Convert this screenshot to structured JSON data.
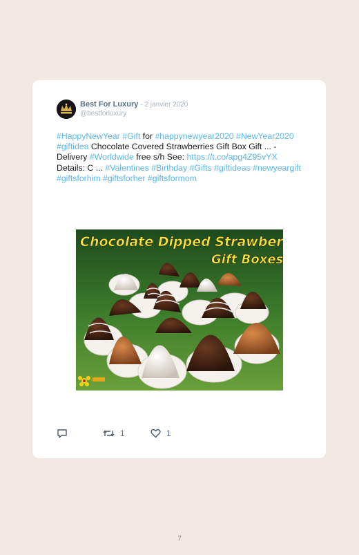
{
  "post": {
    "author_name": "Best For Luxury",
    "date": "- 2 janvier 2020",
    "handle": "@bestforluxury",
    "text_parts": [
      {
        "text": "#HappyNewYear",
        "tag": true
      },
      {
        "text": " "
      },
      {
        "text": "#Gift",
        "tag": true
      },
      {
        "text": " for "
      },
      {
        "text": "#happynewyear2020",
        "tag": true
      },
      {
        "text": " "
      },
      {
        "text": "#NewYear2020",
        "tag": true
      },
      {
        "text": " "
      },
      {
        "text": "#giftidea",
        "tag": true
      },
      {
        "text": " Chocolate Covered Strawberries Gift Box Gift ... - Delivery "
      },
      {
        "text": "#Worldwide",
        "tag": true
      },
      {
        "text": " free s/h See: "
      },
      {
        "text": "https://t.co/apg4Z95vYX",
        "tag": true
      },
      {
        "text": " Details: C ... "
      },
      {
        "text": "#Valentines",
        "tag": true
      },
      {
        "text": " "
      },
      {
        "text": "#Birthday",
        "tag": true
      },
      {
        "text": " "
      },
      {
        "text": "#Gifts",
        "tag": true
      },
      {
        "text": " "
      },
      {
        "text": "#giftideas",
        "tag": true
      },
      {
        "text": " "
      },
      {
        "text": "#newyeargift",
        "tag": true
      },
      {
        "text": " "
      },
      {
        "text": "#giftsforhim",
        "tag": true
      },
      {
        "text": " "
      },
      {
        "text": "#giftsforher",
        "tag": true
      },
      {
        "text": " "
      },
      {
        "text": "#giftsformom",
        "tag": true
      }
    ],
    "image_title_line1": "Chocolate Dipped Strawberries",
    "image_title_line2": "Gift Boxes",
    "actions": {
      "reply_icon": "reply-icon",
      "retweet_icon": "retweet-icon",
      "retweet_count": "1",
      "like_icon": "heart-icon",
      "like_count": "1"
    }
  },
  "page_number": "7",
  "colors": {
    "background": "#efe8e3",
    "card": "#ffffff",
    "hashtag": "#5ab7e8",
    "name": "#5b6f82"
  }
}
